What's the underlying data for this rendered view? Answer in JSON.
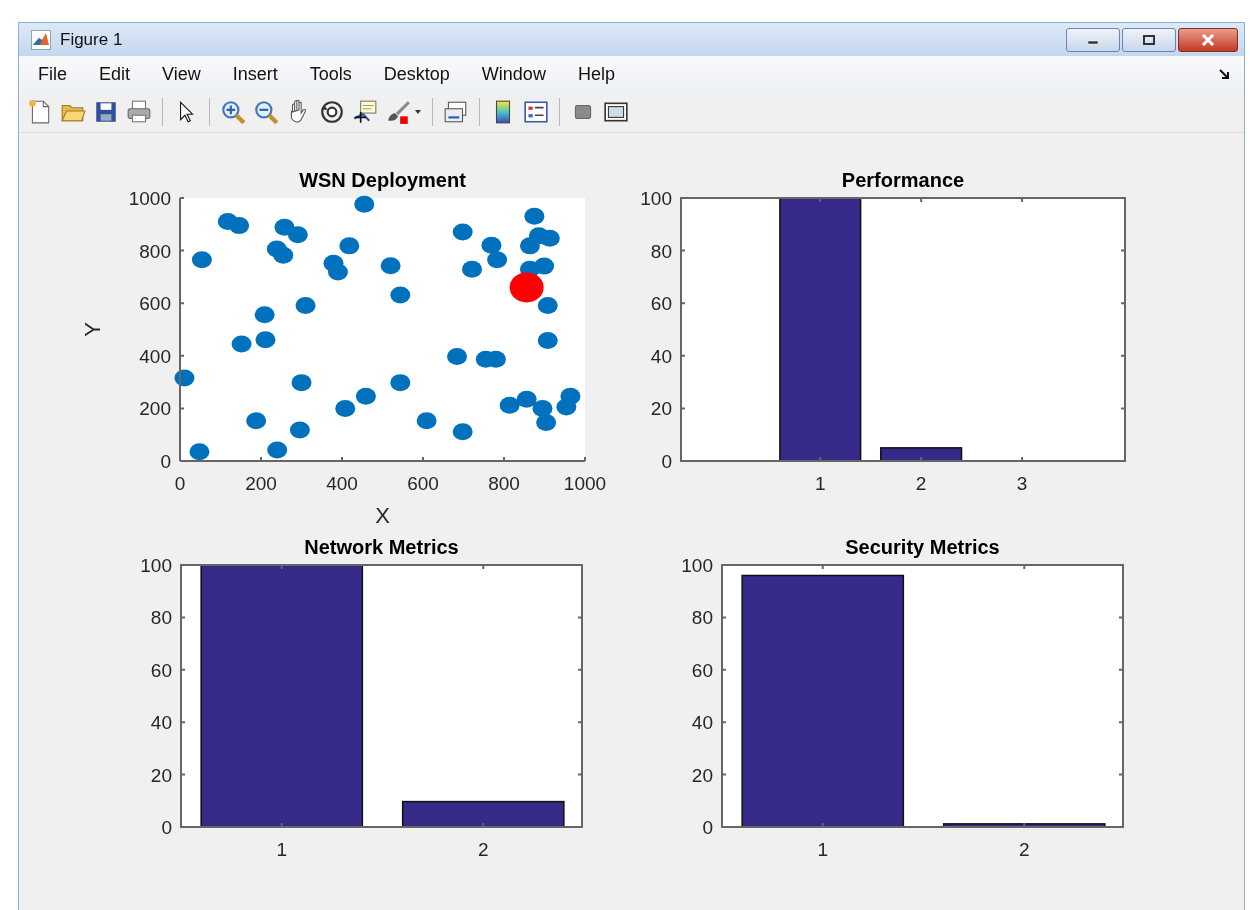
{
  "window": {
    "title": "Figure 1"
  },
  "menu": [
    "File",
    "Edit",
    "View",
    "Insert",
    "Tools",
    "Desktop",
    "Window",
    "Help"
  ],
  "charts": [
    {
      "chart_data": {
        "type": "scatter",
        "title": "WSN Deployment",
        "xlabel": "X",
        "ylabel": "Y",
        "xlim": [
          0,
          1000
        ],
        "ylim": [
          0,
          1000
        ],
        "xticks": [
          0,
          200,
          400,
          600,
          800,
          1000
        ],
        "yticks": [
          0,
          200,
          400,
          600,
          800,
          1000
        ],
        "series": [
          {
            "color": "#0072bd",
            "x": [
              11,
              54,
              118,
              146,
              48,
              152,
              209,
              211,
              188,
              239,
              255,
              258,
              291,
              310,
              300,
              296,
              240,
              379,
              390,
              418,
              455,
              408,
              459,
              520,
              544,
              544,
              609,
              698,
              684,
              698,
              721,
              769,
              783,
              755,
              780,
              814,
              856,
              895,
              904,
              954,
              964,
              908,
              908,
              864,
              899,
              864,
              886,
              913,
              875
            ],
            "values": [
              316,
              765,
              911,
              895,
              35,
              445,
              556,
              461,
              153,
              806,
              782,
              889,
              860,
              591,
              298,
              118,
              42,
              752,
              719,
              818,
              976,
              200,
              246,
              742,
              631,
              298,
              153,
              111,
              397,
              871,
              729,
              820,
              765,
              387,
              387,
              212,
              235,
              200,
              146,
              205,
              246,
              458,
              591,
              729,
              741,
              818,
              856,
              847,
              931
            ]
          },
          {
            "color": "#ff0000",
            "x": [
              856
            ],
            "values": [
              660
            ]
          }
        ]
      }
    },
    {
      "chart_data": {
        "type": "bar",
        "title": "Performance",
        "categories": [
          "1",
          "2",
          "3"
        ],
        "values": [
          100,
          5,
          0
        ],
        "ylim": [
          0,
          100
        ],
        "yticks": [
          0,
          20,
          40,
          60,
          80,
          100
        ]
      }
    },
    {
      "chart_data": {
        "type": "bar",
        "title": "Network Metrics",
        "categories": [
          "1",
          "2"
        ],
        "values": [
          100,
          9.7
        ],
        "ylim": [
          0,
          100
        ],
        "yticks": [
          0,
          20,
          40,
          60,
          80,
          100
        ]
      }
    },
    {
      "chart_data": {
        "type": "bar",
        "title": "Security Metrics",
        "categories": [
          "1",
          "2"
        ],
        "values": [
          96,
          1.2
        ],
        "ylim": [
          0,
          100
        ],
        "yticks": [
          0,
          20,
          40,
          60,
          80,
          100
        ]
      }
    }
  ]
}
